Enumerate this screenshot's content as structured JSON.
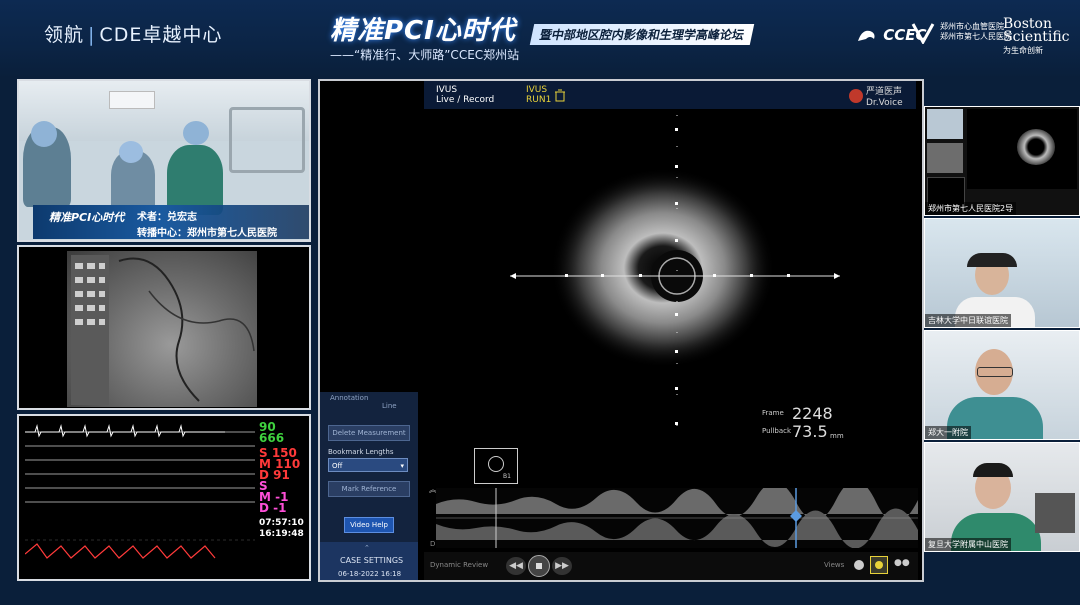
{
  "header": {
    "brand_left": "领航",
    "brand_right": "CDE卓越中心",
    "title_main": "精准PCI心时代",
    "title_sub": "暨中部地区腔内影像和生理学高峰论坛",
    "title_line": "——“精准行、大师路”CCEC郑州站",
    "logos": {
      "ccec": "CCEC",
      "hospital_line1": "郑州市心血管医院",
      "hospital_line2": "郑州市第七人民医院",
      "boston_1": "Boston",
      "boston_2": "Scientific",
      "boston_3": "为生命创新"
    }
  },
  "operating_room": {
    "banner_title": "精准PCI心时代",
    "surgeon_label": "术者：兑宏志",
    "center_label": "转播中心：郑州市第七人民医院"
  },
  "ecg": {
    "hr": "90",
    "spo2": "666",
    "s_val": "S 150",
    "m_val": "M 110",
    "d_val": "D 91",
    "s2": "S",
    "m2": "M -1",
    "d2": "D -1",
    "time1": "07:57:10",
    "time2": "16:19:48"
  },
  "ivus": {
    "mode_line1": "IVUS",
    "mode_line2": "Live / Record",
    "run_line1": "IVUS",
    "run_line2": "RUN1",
    "watermark_1": "严道医声",
    "watermark_2": "Dr.Voice",
    "frame_label": "Frame",
    "frame_value": "2248",
    "pullback_label": "Pullback",
    "pullback_value": "73.5",
    "pullback_unit": "mm",
    "sidebar": {
      "annotation": "Annotation",
      "line": "Line",
      "delete_measurement": "Delete Measurement",
      "bookmark_lengths": "Bookmark Lengths",
      "bookmark_value": "Off",
      "mark_reference": "Mark Reference",
      "video_help": "Video Help",
      "case_settings": "CASE SETTINGS",
      "date": "06-18-2022 16:18"
    },
    "bottom": {
      "dynamic_review": "Dynamic Review",
      "views": "Views",
      "b1": "B1"
    }
  },
  "participants": [
    {
      "caption": "郑州市第七人民医院2导"
    },
    {
      "caption": "吉林大学中日联谊医院"
    },
    {
      "caption": "郑大一附院"
    },
    {
      "caption": "复旦大学附属中山医院"
    }
  ],
  "colors": {
    "accent_yellow": "#e8d23a",
    "ecg_green": "#3fd23f",
    "ecg_red": "#ff3a3a",
    "ecg_magenta": "#ff4fd8",
    "panel_border": "#d9dde3"
  }
}
